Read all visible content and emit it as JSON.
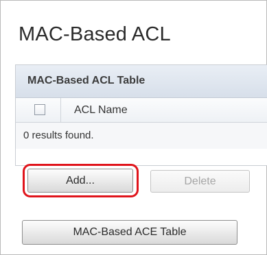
{
  "page": {
    "title": "MAC-Based ACL"
  },
  "table": {
    "caption": "MAC-Based ACL Table",
    "columns": [
      "ACL Name"
    ],
    "rows": [],
    "results_text": "0 results found."
  },
  "actions": {
    "add_label": "Add...",
    "delete_label": "Delete",
    "delete_enabled": false,
    "ace_table_label": "MAC-Based ACE Table"
  },
  "annotation": {
    "highlight_target": "add-button",
    "highlight_color": "#e0141b"
  },
  "colors": {
    "caption_bg": "#dde4ee",
    "border": "#c9cdd3"
  }
}
